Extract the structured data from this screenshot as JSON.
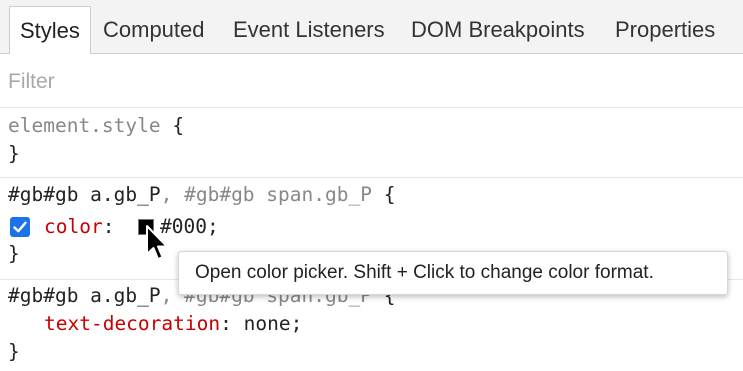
{
  "tabs": [
    {
      "label": "Styles",
      "selected": true
    },
    {
      "label": "Computed",
      "selected": false
    },
    {
      "label": "Event Listeners",
      "selected": false
    },
    {
      "label": "DOM Breakpoints",
      "selected": false
    },
    {
      "label": "Properties",
      "selected": false
    }
  ],
  "filter": {
    "placeholder": "Filter",
    "value": ""
  },
  "rules": [
    {
      "selector": "element.style",
      "open_brace": " {",
      "close_brace": "}"
    },
    {
      "selector_active": "#gb#gb a.gb_P",
      "selector_sep": ", ",
      "selector_inactive": "#gb#gb span.gb_P",
      "open_brace": " {",
      "close_brace": "}",
      "property": {
        "name": "color",
        "colon": ": ",
        "value": "#000",
        "semicolon": ";",
        "checked": true,
        "swatch_color": "#000000"
      }
    },
    {
      "selector_active": "#gb#gb a.gb_P",
      "selector_sep": ", ",
      "selector_inactive": "#gb#gb span.gb_P",
      "open_brace": " {",
      "close_brace": "}",
      "property": {
        "name": "text-decoration",
        "colon": ": ",
        "value": "none",
        "semicolon": ";"
      }
    }
  ],
  "tooltip": {
    "text": "Open color picker. Shift + Click to change color format."
  },
  "colors": {
    "accent": "#1a73e8",
    "property_name": "#c80000",
    "inactive_selector": "#888888"
  },
  "icons": {
    "checkbox": "checkmark-icon",
    "cursor": "mouse-pointer-icon"
  }
}
